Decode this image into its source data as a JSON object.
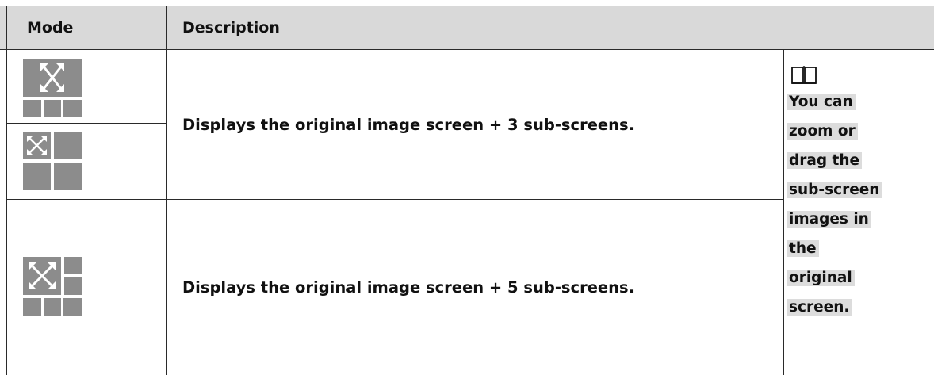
{
  "table": {
    "headers": {
      "mode": "Mode",
      "description": "Description"
    },
    "rows": [
      {
        "icons": [
          "mode-1plus3-icon",
          "mode-1plus3-grid-icon"
        ],
        "description": "Displays the original image screen + 3 sub-screens."
      },
      {
        "icons": [
          "mode-1plus5-icon"
        ],
        "description": "Displays the original image screen + 5 sub-screens."
      }
    ],
    "note": {
      "icon": "book-icon",
      "lines": [
        "You can",
        "zoom or",
        "drag the",
        "sub-screen",
        "images in",
        "the",
        "original",
        "screen."
      ]
    }
  },
  "colors": {
    "header_bg": "#d9d9d9",
    "icon_gray": "#8c8c8c",
    "highlight": "#dcdcdc"
  }
}
